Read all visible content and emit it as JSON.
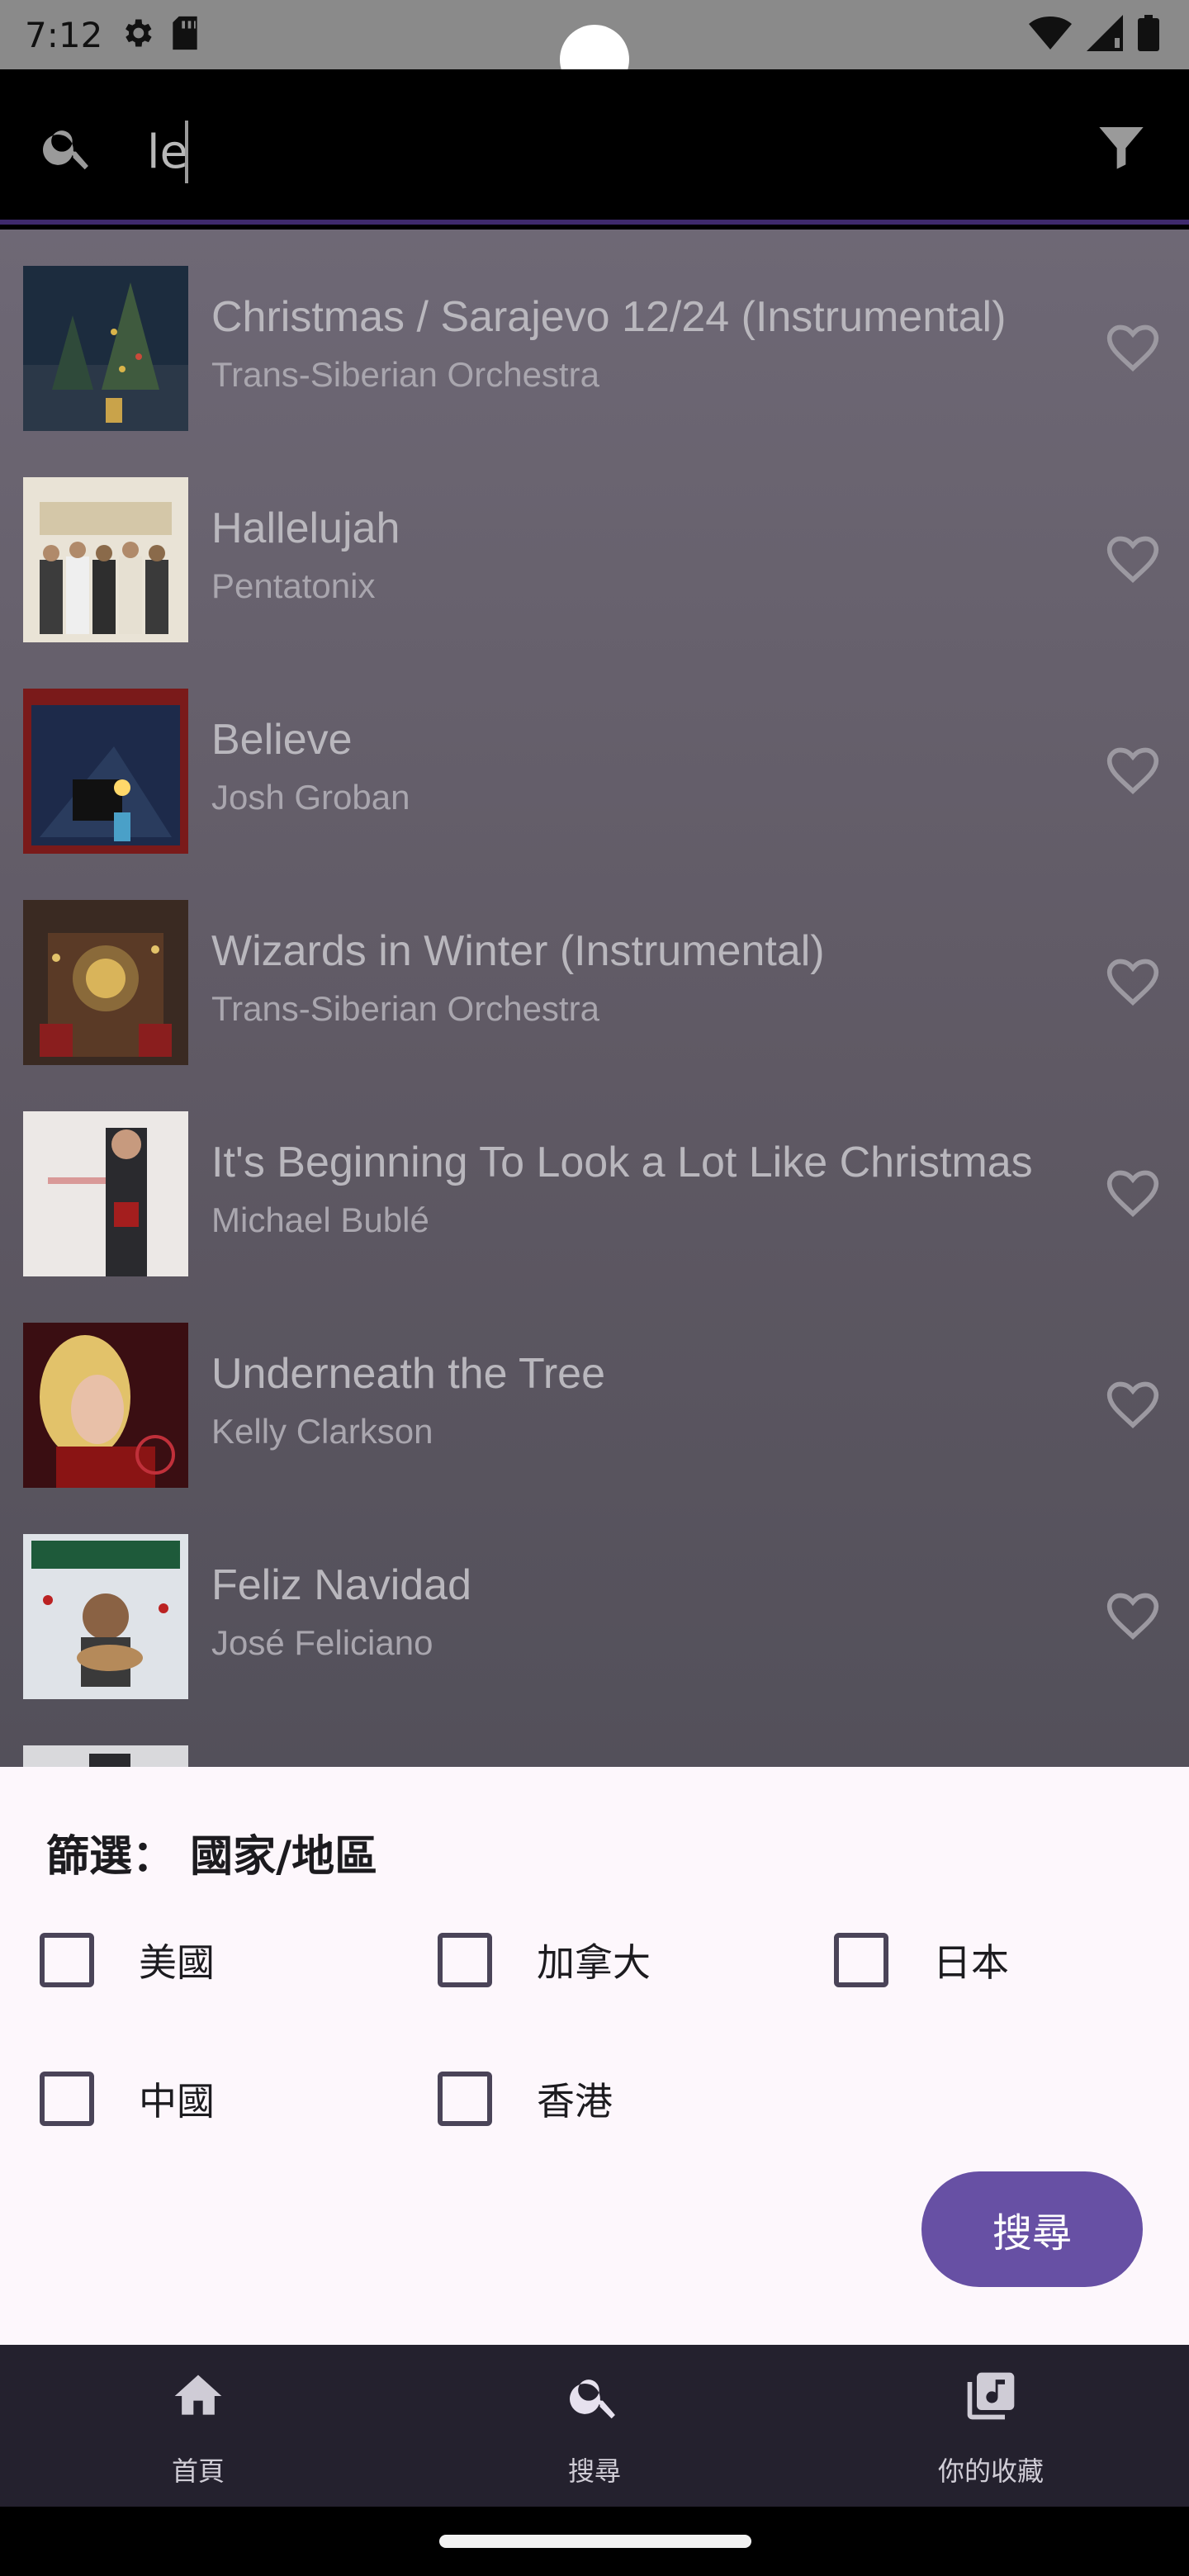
{
  "status_bar": {
    "time": "7:12"
  },
  "search": {
    "query": "le"
  },
  "songs": [
    {
      "title": "Christmas / Sarajevo 12/24 (Instrumental)",
      "artist": "Trans-Siberian Orchestra"
    },
    {
      "title": "Hallelujah",
      "artist": "Pentatonix"
    },
    {
      "title": "Believe",
      "artist": "Josh Groban"
    },
    {
      "title": "Wizards in Winter (Instrumental)",
      "artist": "Trans-Siberian Orchestra"
    },
    {
      "title": "It's Beginning To Look a Lot Like Christmas",
      "artist": "Michael Bublé"
    },
    {
      "title": "Underneath the Tree",
      "artist": "Kelly Clarkson"
    },
    {
      "title": "Feliz Navidad",
      "artist": "José Feliciano"
    }
  ],
  "filter_sheet": {
    "title": "篩選： 國家/地區",
    "options": [
      "美國",
      "加拿大",
      "日本",
      "中國",
      "香港"
    ],
    "search_button": "搜尋"
  },
  "bottom_nav": {
    "items": [
      {
        "label": "首頁",
        "icon": "home-icon"
      },
      {
        "label": "搜尋",
        "icon": "search-icon"
      },
      {
        "label": "你的收藏",
        "icon": "library-music-icon"
      }
    ]
  },
  "colors": {
    "accent": "#6750a4",
    "nav_background": "#24212e",
    "sheet_background": "#fdf7fc"
  }
}
